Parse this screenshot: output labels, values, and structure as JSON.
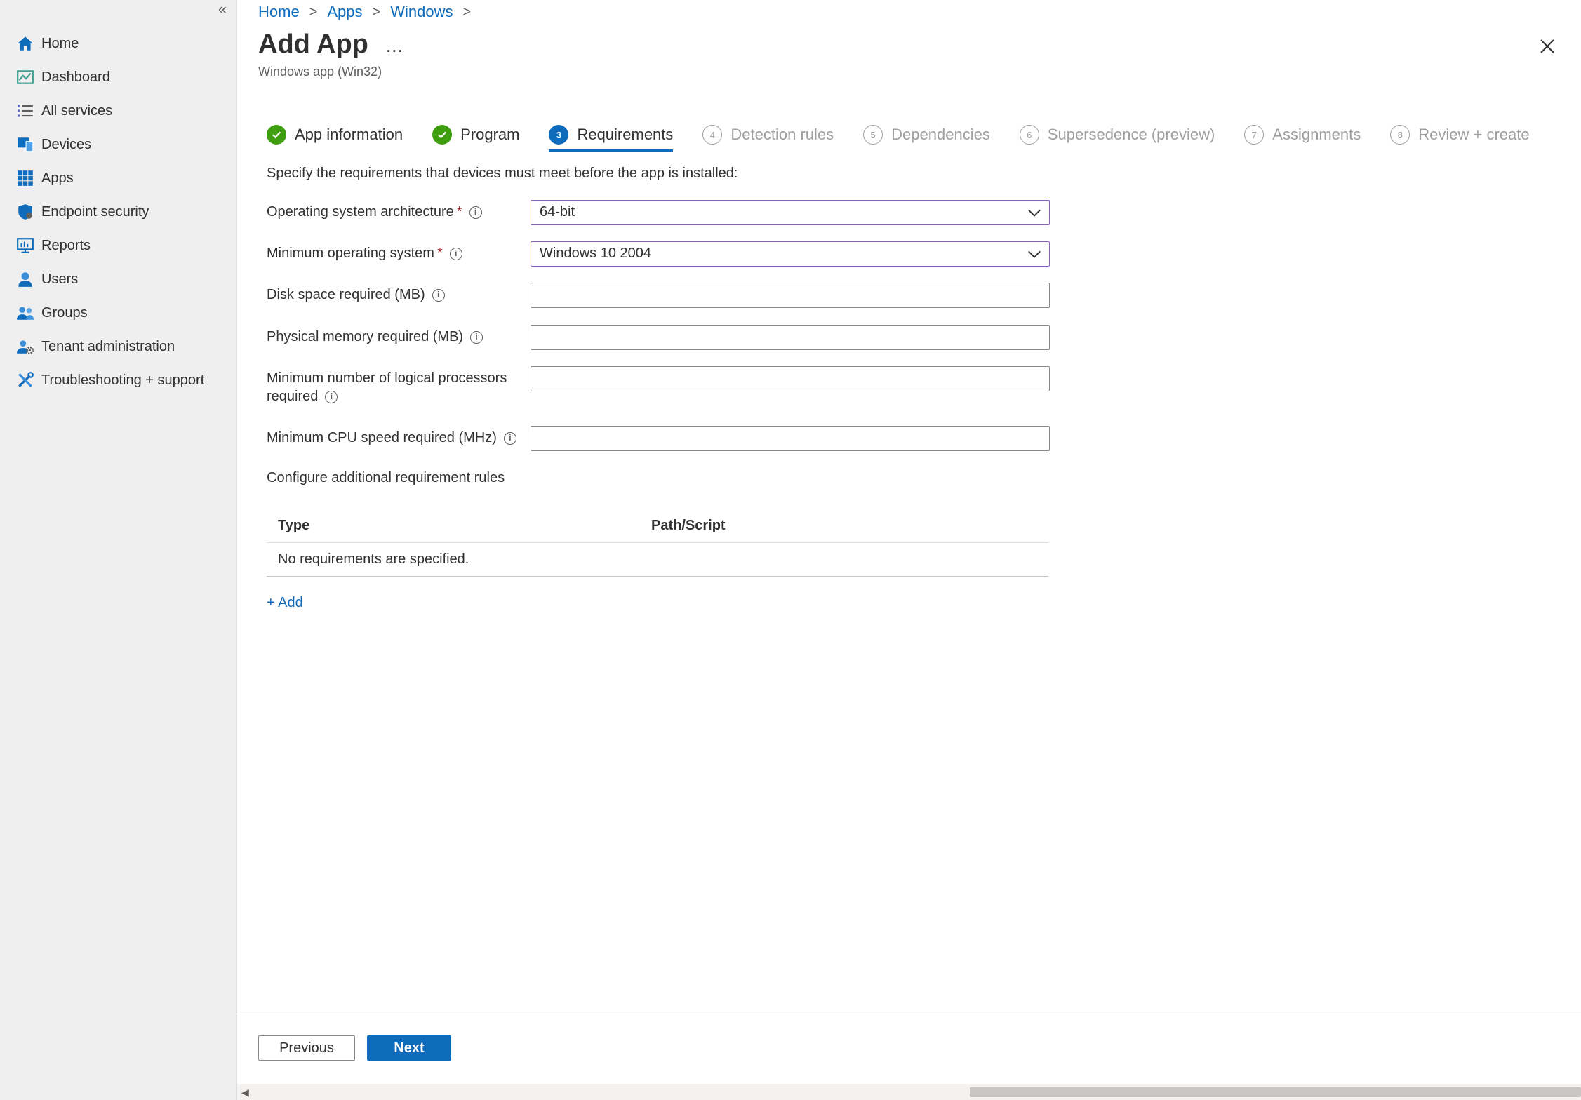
{
  "sidebar": {
    "collapse_icon": "double-chevron-left-icon",
    "items": [
      {
        "label": "Home",
        "icon": "home-icon"
      },
      {
        "label": "Dashboard",
        "icon": "dashboard-icon"
      },
      {
        "label": "All services",
        "icon": "list-icon"
      },
      {
        "label": "Devices",
        "icon": "devices-icon"
      },
      {
        "label": "Apps",
        "icon": "apps-grid-icon"
      },
      {
        "label": "Endpoint security",
        "icon": "shield-icon"
      },
      {
        "label": "Reports",
        "icon": "reports-icon"
      },
      {
        "label": "Users",
        "icon": "user-icon"
      },
      {
        "label": "Groups",
        "icon": "groups-icon"
      },
      {
        "label": "Tenant administration",
        "icon": "tenant-gear-icon"
      },
      {
        "label": "Troubleshooting + support",
        "icon": "tools-icon"
      }
    ]
  },
  "breadcrumb": [
    "Home",
    "Apps",
    "Windows"
  ],
  "header": {
    "title": "Add App",
    "more": "...",
    "subtitle": "Windows app (Win32)"
  },
  "steps": [
    {
      "label": "App information",
      "state": "done",
      "num": ""
    },
    {
      "label": "Program",
      "state": "done",
      "num": ""
    },
    {
      "label": "Requirements",
      "state": "active",
      "num": "3"
    },
    {
      "label": "Detection rules",
      "state": "pending",
      "num": "4"
    },
    {
      "label": "Dependencies",
      "state": "pending",
      "num": "5"
    },
    {
      "label": "Supersedence (preview)",
      "state": "pending",
      "num": "6"
    },
    {
      "label": "Assignments",
      "state": "pending",
      "num": "7"
    },
    {
      "label": "Review + create",
      "state": "pending",
      "num": "8"
    }
  ],
  "form": {
    "description": "Specify the requirements that devices must meet before the app is installed:",
    "os_arch_label": "Operating system architecture",
    "os_arch_value": "64-bit",
    "min_os_label": "Minimum operating system",
    "min_os_value": "Windows 10 2004",
    "disk_label": "Disk space required (MB)",
    "disk_value": "",
    "memory_label": "Physical memory required (MB)",
    "memory_value": "",
    "processors_label_1": "Minimum number of logical processors",
    "processors_label_2": "required",
    "processors_value": "",
    "cpu_label": "Minimum CPU speed required (MHz)",
    "cpu_value": "",
    "required_mark": "*",
    "info_glyph": "i"
  },
  "rules": {
    "title": "Configure additional requirement rules",
    "col_type": "Type",
    "col_path": "Path/Script",
    "empty": "No requirements are specified.",
    "add": "+ Add"
  },
  "footer": {
    "previous": "Previous",
    "next": "Next"
  },
  "colors": {
    "accent": "#0f6cbd",
    "done": "#3f9e0f",
    "select_border": "#8764b8",
    "required": "#a4262c"
  }
}
